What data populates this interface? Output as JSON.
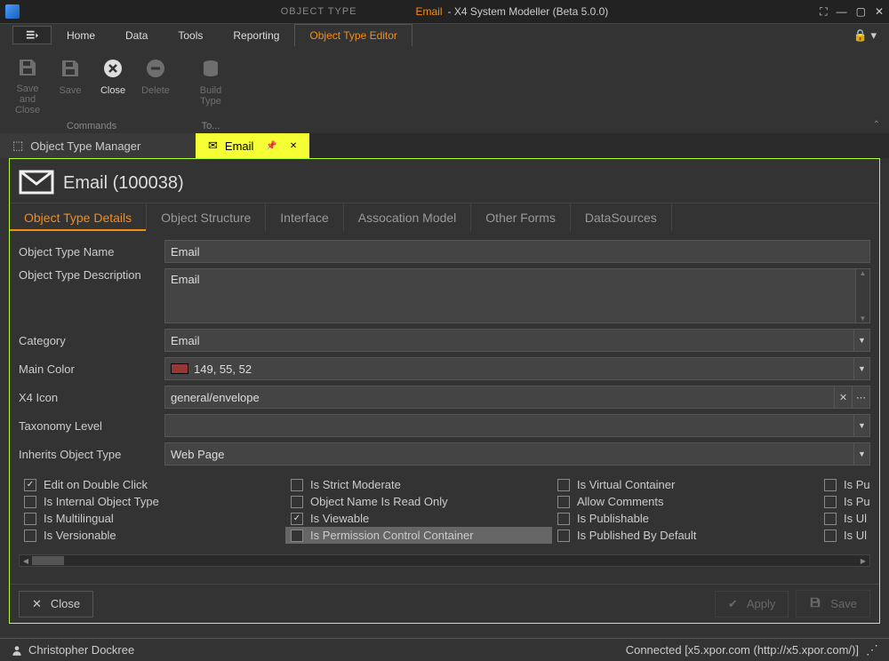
{
  "titlebar": {
    "type_label": "OBJECT TYPE",
    "doc_name": "Email",
    "separator": " - ",
    "app_name": "X4 System Modeller (Beta 5.0.0)"
  },
  "main_menu": {
    "items": [
      "Home",
      "Data",
      "Tools",
      "Reporting",
      "Object Type Editor"
    ],
    "active_index": 4
  },
  "ribbon": {
    "groups": [
      {
        "label": "Commands",
        "buttons": [
          {
            "label": "Save and\nClose",
            "icon": "save",
            "disabled": true
          },
          {
            "label": "Save",
            "icon": "save",
            "disabled": true
          },
          {
            "label": "Close",
            "icon": "close",
            "disabled": false
          },
          {
            "label": "Delete",
            "icon": "delete",
            "disabled": true
          }
        ]
      },
      {
        "label": "To...",
        "buttons": [
          {
            "label": "Build\nType",
            "icon": "build",
            "disabled": true
          }
        ]
      }
    ]
  },
  "doc_tabs": [
    {
      "label": "Object Type Manager",
      "icon": "cube",
      "active": false
    },
    {
      "label": "Email",
      "icon": "mail",
      "active": true
    }
  ],
  "panel": {
    "title": "Email (100038)"
  },
  "inner_tabs": {
    "items": [
      "Object Type Details",
      "Object Structure",
      "Interface",
      "Assocation Model",
      "Other Forms",
      "DataSources"
    ],
    "active_index": 0
  },
  "form": {
    "name_label": "Object Type Name",
    "name_value": "Email",
    "desc_label": "Object Type Description",
    "desc_value": "Email",
    "category_label": "Category",
    "category_value": "Email",
    "color_label": "Main Color",
    "color_value": "149, 55, 52",
    "color_hex": "#953734",
    "icon_label": "X4 Icon",
    "icon_value": "general/envelope",
    "taxonomy_label": "Taxonomy Level",
    "taxonomy_value": "",
    "inherits_label": "Inherits Object Type",
    "inherits_value": "Web Page"
  },
  "checks": {
    "col1": [
      {
        "label": "Edit on Double Click",
        "checked": true
      },
      {
        "label": "Is Internal Object Type",
        "checked": false
      },
      {
        "label": "Is Multilingual",
        "checked": false
      },
      {
        "label": "Is Versionable",
        "checked": false
      }
    ],
    "col2": [
      {
        "label": "Is Strict Moderate",
        "checked": false
      },
      {
        "label": "Object Name Is Read Only",
        "checked": false
      },
      {
        "label": "Is Viewable",
        "checked": true
      },
      {
        "label": "Is Permission Control Container",
        "checked": false,
        "highlighted": true
      }
    ],
    "col3": [
      {
        "label": "Is Virtual Container",
        "checked": false
      },
      {
        "label": "Allow Comments",
        "checked": false
      },
      {
        "label": "Is Publishable",
        "checked": false
      },
      {
        "label": "Is Published By Default",
        "checked": false
      }
    ],
    "col4": [
      {
        "label": "Is Pu",
        "checked": false
      },
      {
        "label": "Is Pu",
        "checked": false
      },
      {
        "label": "Is Ul",
        "checked": false
      },
      {
        "label": "Is Ul",
        "checked": false
      }
    ]
  },
  "footer": {
    "close": "Close",
    "apply": "Apply",
    "save": "Save"
  },
  "status": {
    "user": "Christopher Dockree",
    "conn": "Connected [x5.xpor.com (http://x5.xpor.com/)]"
  }
}
